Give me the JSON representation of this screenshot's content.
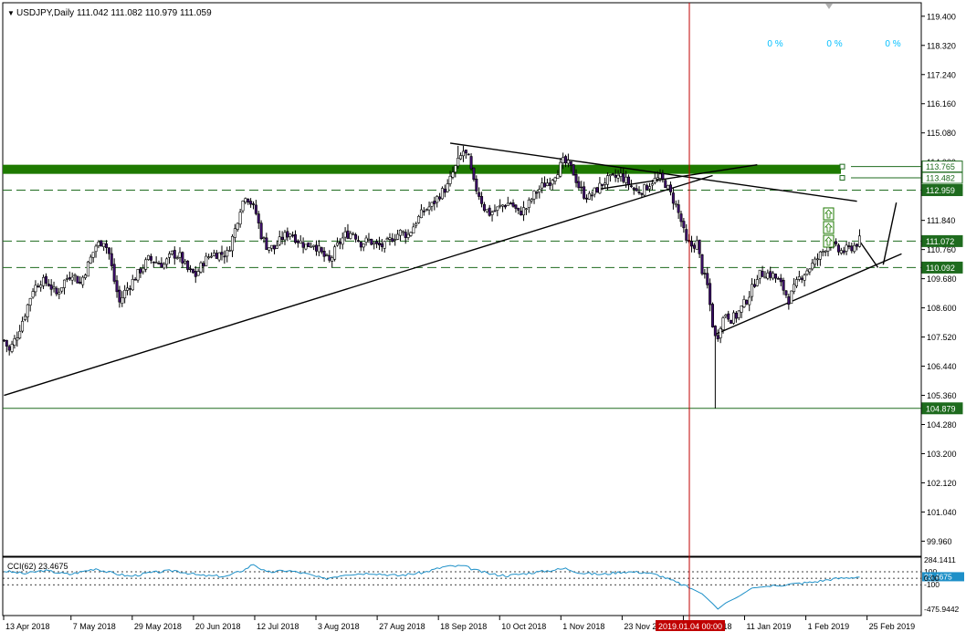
{
  "chart_data": {
    "type": "candlestick",
    "symbol": "USDJPY",
    "timeframe": "Daily",
    "header_text": "USDJPY,Daily  111.042 111.082 110.979 111.059",
    "ohlc": {
      "open": 111.042,
      "high": 111.082,
      "low": 110.979,
      "close": 111.059
    },
    "ylim": [
      99.4,
      119.9
    ],
    "y_ticks": [
      "119.400",
      "118.320",
      "117.240",
      "116.160",
      "115.080",
      "114.000",
      "112.920",
      "111.840",
      "110.760",
      "109.680",
      "108.600",
      "107.520",
      "106.440",
      "105.360",
      "104.280",
      "103.200",
      "102.120",
      "101.040",
      "99.960"
    ],
    "x_ticks": [
      "13 Apr 2018",
      "7 May 2018",
      "29 May 2018",
      "20 Jun 2018",
      "12 Jul 2018",
      "3 Aug 2018",
      "27 Aug 2018",
      "18 Sep 2018",
      "10 Oct 2018",
      "1 Nov 2018",
      "23 Nov 2018",
      "17 Dec 2018",
      "11 Jan 2019",
      "1 Feb 2019",
      "25 Feb 2019"
    ],
    "crosshair_label": "2019.01.04 00:00",
    "percent_labels": [
      "0 %",
      "0 %",
      "0 %"
    ],
    "horizontal_levels": [
      {
        "price": 113.765,
        "label": "113.765",
        "style": "zone-top"
      },
      {
        "price": 113.482,
        "label": "113.482",
        "style": "zone-bottom"
      },
      {
        "price": 112.959,
        "label": "112.959",
        "style": "dashed"
      },
      {
        "price": 111.072,
        "label": "111.072",
        "style": "dashed"
      },
      {
        "price": 110.092,
        "label": "110.092",
        "style": "dashed"
      },
      {
        "price": 104.879,
        "label": "104.879",
        "style": "solid"
      }
    ],
    "price_path": [
      [
        0,
        107.4
      ],
      [
        2,
        107.0
      ],
      [
        5,
        107.6
      ],
      [
        8,
        108.4
      ],
      [
        11,
        109.3
      ],
      [
        14,
        109.6
      ],
      [
        17,
        109.5
      ],
      [
        20,
        109.1
      ],
      [
        23,
        109.6
      ],
      [
        26,
        109.9
      ],
      [
        29,
        109.5
      ],
      [
        32,
        110.2
      ],
      [
        35,
        110.9
      ],
      [
        38,
        111.1
      ],
      [
        40,
        110.6
      ],
      [
        42,
        109.6
      ],
      [
        44,
        108.8
      ],
      [
        46,
        109.2
      ],
      [
        49,
        109.6
      ],
      [
        52,
        110.0
      ],
      [
        55,
        110.4
      ],
      [
        58,
        110.3
      ],
      [
        61,
        110.2
      ],
      [
        64,
        110.6
      ],
      [
        67,
        110.5
      ],
      [
        70,
        110.0
      ],
      [
        73,
        109.8
      ],
      [
        76,
        110.3
      ],
      [
        79,
        110.6
      ],
      [
        82,
        110.6
      ],
      [
        85,
        110.6
      ],
      [
        88,
        111.5
      ],
      [
        90,
        112.3
      ],
      [
        92,
        112.8
      ],
      [
        94,
        112.5
      ],
      [
        96,
        112.1
      ],
      [
        98,
        111.3
      ],
      [
        100,
        110.9
      ],
      [
        103,
        110.8
      ],
      [
        106,
        111.2
      ],
      [
        109,
        111.4
      ],
      [
        112,
        111.1
      ],
      [
        115,
        110.9
      ],
      [
        118,
        111.0
      ],
      [
        121,
        110.6
      ],
      [
        124,
        110.3
      ],
      [
        127,
        110.9
      ],
      [
        130,
        111.3
      ],
      [
        133,
        111.4
      ],
      [
        136,
        111.0
      ],
      [
        139,
        111.1
      ],
      [
        142,
        110.9
      ],
      [
        145,
        110.9
      ],
      [
        148,
        111.2
      ],
      [
        151,
        111.4
      ],
      [
        154,
        111.3
      ],
      [
        157,
        111.8
      ],
      [
        160,
        112.2
      ],
      [
        163,
        112.4
      ],
      [
        166,
        112.8
      ],
      [
        169,
        113.1
      ],
      [
        171,
        113.6
      ],
      [
        173,
        114.0
      ],
      [
        175,
        114.4
      ],
      [
        177,
        114.1
      ],
      [
        179,
        113.2
      ],
      [
        181,
        112.8
      ],
      [
        183,
        112.3
      ],
      [
        185,
        112.1
      ],
      [
        187,
        112.2
      ],
      [
        190,
        112.4
      ],
      [
        193,
        112.5
      ],
      [
        196,
        112.1
      ],
      [
        199,
        112.3
      ],
      [
        202,
        112.8
      ],
      [
        205,
        113.1
      ],
      [
        208,
        113.3
      ],
      [
        211,
        113.7
      ],
      [
        213,
        114.0
      ],
      [
        215,
        113.9
      ],
      [
        217,
        113.6
      ],
      [
        219,
        113.1
      ],
      [
        221,
        112.8
      ],
      [
        223,
        112.7
      ],
      [
        226,
        113.0
      ],
      [
        229,
        113.3
      ],
      [
        232,
        113.4
      ],
      [
        235,
        113.5
      ],
      [
        238,
        113.2
      ],
      [
        241,
        112.9
      ],
      [
        244,
        113.0
      ],
      [
        247,
        113.3
      ],
      [
        250,
        113.4
      ],
      [
        252,
        113.2
      ],
      [
        254,
        112.8
      ],
      [
        256,
        112.4
      ],
      [
        258,
        111.8
      ],
      [
        260,
        111.0
      ],
      [
        262,
        110.9
      ],
      [
        264,
        111.0
      ],
      [
        266,
        110.0
      ],
      [
        268,
        109.4
      ],
      [
        270,
        108.0
      ],
      [
        271,
        107.5
      ],
      [
        272,
        107.6
      ],
      [
        273,
        108.0
      ],
      [
        275,
        108.4
      ],
      [
        277,
        108.2
      ],
      [
        279,
        108.3
      ],
      [
        281,
        108.6
      ],
      [
        283,
        108.9
      ],
      [
        285,
        109.3
      ],
      [
        287,
        109.8
      ],
      [
        290,
        109.9
      ],
      [
        293,
        109.8
      ],
      [
        295,
        109.6
      ],
      [
        297,
        109.3
      ],
      [
        299,
        108.9
      ],
      [
        301,
        109.3
      ],
      [
        303,
        109.7
      ],
      [
        306,
        110.0
      ],
      [
        309,
        110.3
      ],
      [
        312,
        110.7
      ],
      [
        314,
        111.0
      ],
      [
        316,
        110.9
      ],
      [
        318,
        110.7
      ],
      [
        320,
        110.7
      ],
      [
        322,
        110.8
      ],
      [
        324,
        110.9
      ],
      [
        326,
        111.1
      ]
    ],
    "cci": {
      "label": "CCI(62) 23.4675",
      "value": 23.4675,
      "ylim": [
        -560,
        310
      ],
      "ticks": [
        {
          "label": "284.1411",
          "value": 284.1411
        },
        {
          "label": "100",
          "value": 100
        },
        {
          "label": "23.4675",
          "value": 23.4675
        },
        {
          "label": "0.00",
          "value": 0
        },
        {
          "label": "-100",
          "value": -100
        },
        {
          "label": "-475.9442",
          "value": -475.9442
        }
      ],
      "path": [
        [
          0,
          110
        ],
        [
          8,
          70
        ],
        [
          15,
          120
        ],
        [
          25,
          60
        ],
        [
          35,
          150
        ],
        [
          40,
          90
        ],
        [
          48,
          30
        ],
        [
          55,
          80
        ],
        [
          65,
          120
        ],
        [
          75,
          40
        ],
        [
          85,
          30
        ],
        [
          92,
          140
        ],
        [
          95,
          220
        ],
        [
          100,
          90
        ],
        [
          108,
          120
        ],
        [
          115,
          70
        ],
        [
          122,
          -10
        ],
        [
          130,
          60
        ],
        [
          140,
          80
        ],
        [
          150,
          40
        ],
        [
          160,
          90
        ],
        [
          168,
          180
        ],
        [
          175,
          190
        ],
        [
          180,
          120
        ],
        [
          186,
          60
        ],
        [
          192,
          40
        ],
        [
          200,
          80
        ],
        [
          208,
          120
        ],
        [
          214,
          150
        ],
        [
          220,
          80
        ],
        [
          228,
          60
        ],
        [
          236,
          100
        ],
        [
          244,
          90
        ],
        [
          250,
          40
        ],
        [
          256,
          -60
        ],
        [
          262,
          -160
        ],
        [
          266,
          -240
        ],
        [
          270,
          -390
        ],
        [
          272,
          -475
        ],
        [
          275,
          -380
        ],
        [
          280,
          -280
        ],
        [
          285,
          -150
        ],
        [
          292,
          -120
        ],
        [
          300,
          -90
        ],
        [
          308,
          -60
        ],
        [
          316,
          -10
        ],
        [
          322,
          10
        ],
        [
          326,
          23
        ]
      ]
    },
    "trendlines": [
      [
        [
          0,
          105.36
        ],
        [
          270,
          113.5
        ]
      ],
      [
        [
          170,
          114.7
        ],
        [
          325,
          112.55
        ]
      ],
      [
        [
          227,
          113.0
        ],
        [
          287,
          113.9
        ]
      ],
      [
        [
          271,
          107.62
        ],
        [
          342,
          110.6
        ]
      ],
      [
        [
          326,
          111.072
        ],
        [
          333,
          110.092
        ]
      ],
      [
        [
          335,
          110.2
        ],
        [
          340,
          112.5
        ]
      ]
    ],
    "indicator_arrows": 3
  }
}
